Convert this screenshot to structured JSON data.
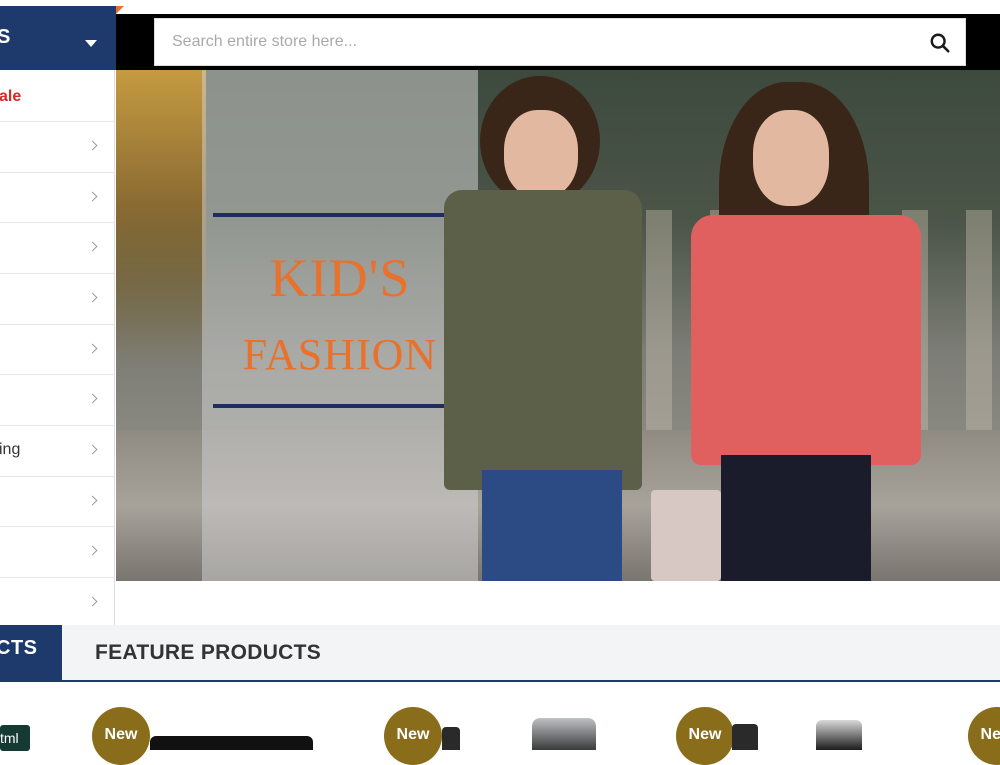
{
  "header": {
    "categories_label": "S",
    "search_placeholder": "Search entire store here..."
  },
  "categories": {
    "sale_label": "ale",
    "items": [
      {
        "label": ""
      },
      {
        "label": ""
      },
      {
        "label": ""
      },
      {
        "label": ""
      },
      {
        "label": ""
      },
      {
        "label": ""
      },
      {
        "label": "ing"
      },
      {
        "label": ""
      },
      {
        "label": ""
      },
      {
        "label": ""
      }
    ]
  },
  "banner": {
    "title": "KID'S",
    "subtitle": "FASHION"
  },
  "sections": {
    "active_tab_label": "CTS",
    "feature_tab_label": "FEATURE PRODUCTS"
  },
  "products": {
    "html_badge": "tml",
    "new_badge": "New"
  },
  "colors": {
    "primary": "#1e3a6d",
    "accent": "#e8722c",
    "sale": "#d42a2a",
    "badge": "#8a6d1b"
  }
}
